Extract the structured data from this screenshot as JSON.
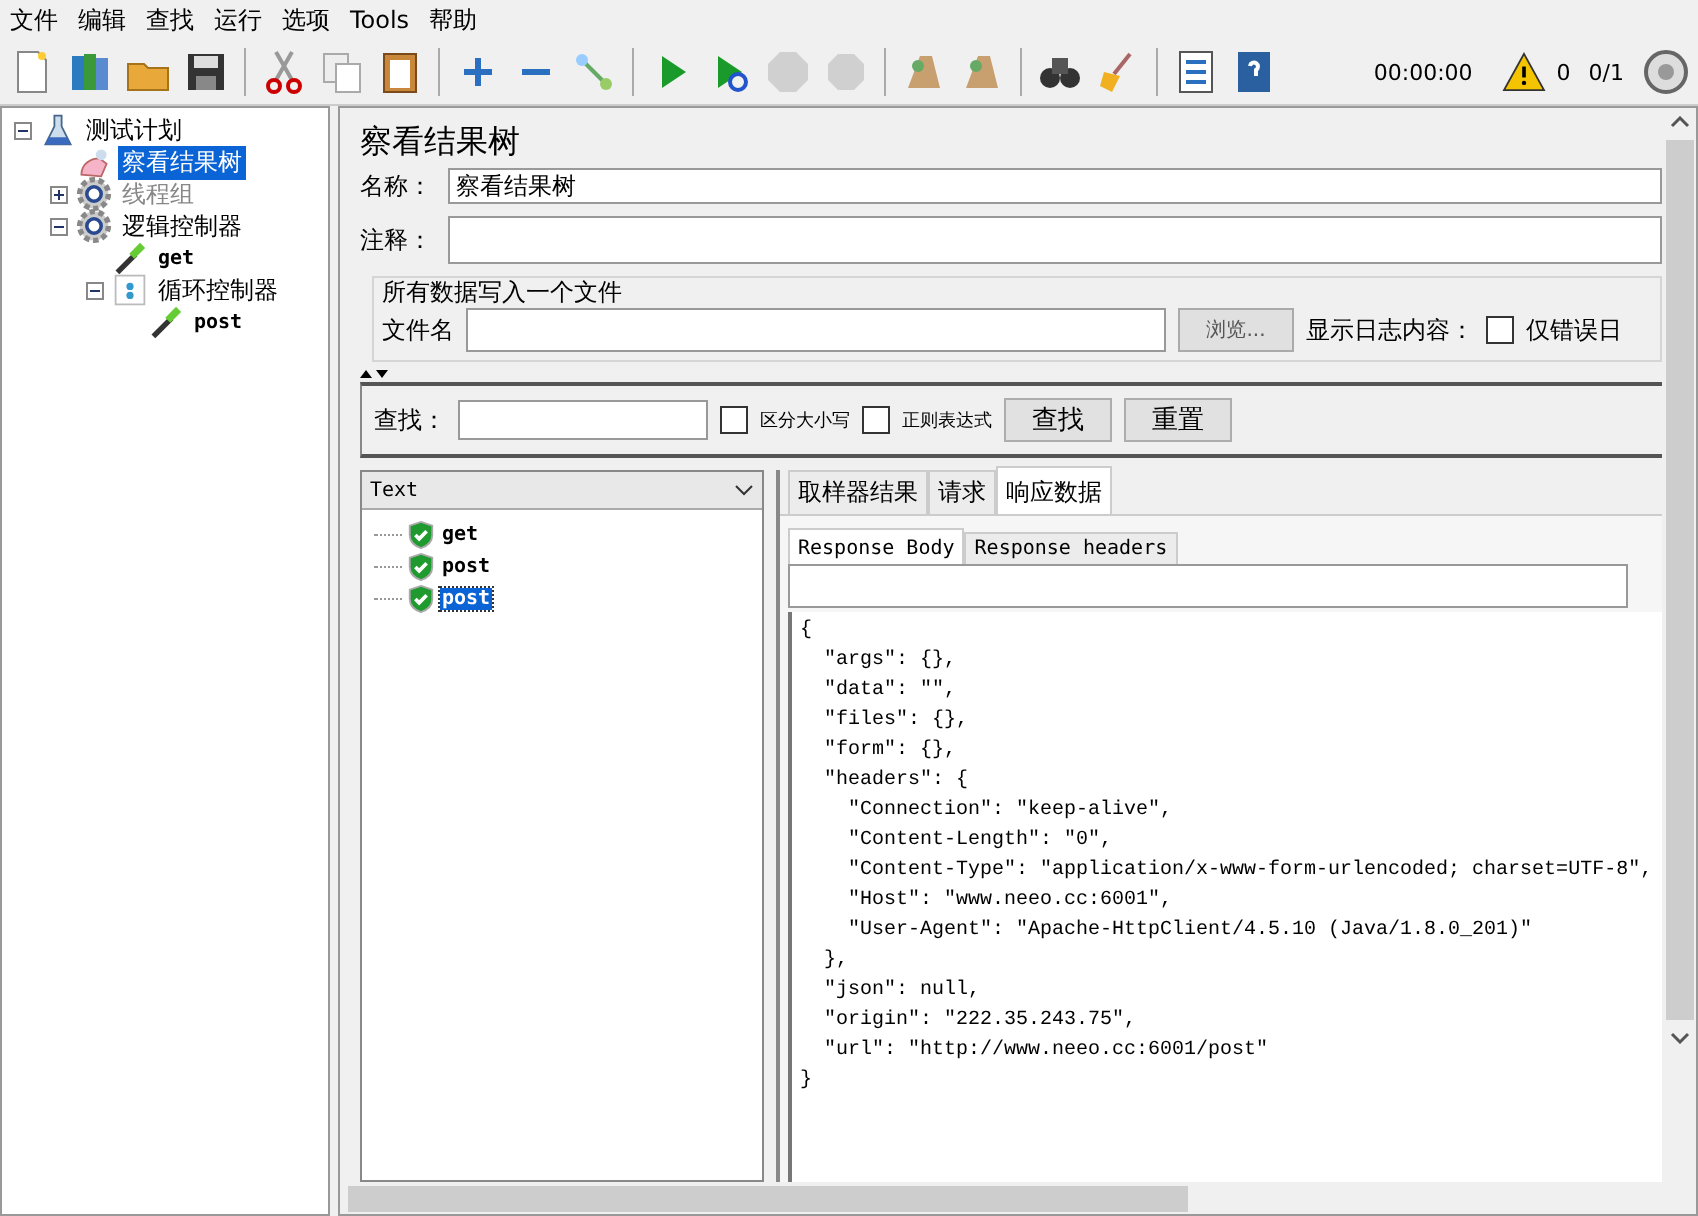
{
  "menu": [
    {
      "label": "文件"
    },
    {
      "label": "编辑"
    },
    {
      "label": "查找"
    },
    {
      "label": "运行"
    },
    {
      "label": "选项"
    },
    {
      "label": "Tools"
    },
    {
      "label": "帮助"
    }
  ],
  "toolbar": {
    "buttons": [
      {
        "kind": "new",
        "disabled": false
      },
      {
        "kind": "templates",
        "disabled": false
      },
      {
        "kind": "open",
        "disabled": false
      },
      {
        "kind": "save",
        "disabled": false
      },
      {
        "kind": "sep"
      },
      {
        "kind": "cut",
        "disabled": false
      },
      {
        "kind": "copy",
        "disabled": false
      },
      {
        "kind": "paste",
        "disabled": false
      },
      {
        "kind": "sep"
      },
      {
        "kind": "expand",
        "disabled": false
      },
      {
        "kind": "collapse",
        "disabled": false
      },
      {
        "kind": "toggle",
        "disabled": false
      },
      {
        "kind": "sep"
      },
      {
        "kind": "start",
        "disabled": false
      },
      {
        "kind": "start-no-timers",
        "disabled": false
      },
      {
        "kind": "stop",
        "disabled": true
      },
      {
        "kind": "shutdown",
        "disabled": true
      },
      {
        "kind": "sep"
      },
      {
        "kind": "clear",
        "disabled": false
      },
      {
        "kind": "clear-all",
        "disabled": false
      },
      {
        "kind": "sep"
      },
      {
        "kind": "search",
        "disabled": false
      },
      {
        "kind": "reset",
        "disabled": false
      },
      {
        "kind": "sep"
      },
      {
        "kind": "functions",
        "disabled": false
      },
      {
        "kind": "help",
        "disabled": false
      }
    ],
    "timer": "00:00:00",
    "warnings": "0",
    "threads": "0/1"
  },
  "tree": [
    {
      "label": "测试计划",
      "kind": "plan",
      "expanded": true,
      "selected": false,
      "disabled": false,
      "children": [
        {
          "label": "察看结果树",
          "kind": "listener",
          "selected": true,
          "disabled": false
        },
        {
          "label": "线程组",
          "kind": "threadgroup",
          "expanded": false,
          "selected": false,
          "disabled": true
        },
        {
          "label": "逻辑控制器",
          "kind": "threadgroup",
          "expanded": true,
          "selected": false,
          "disabled": false,
          "children": [
            {
              "label": "get",
              "kind": "sampler",
              "selected": false,
              "disabled": false
            },
            {
              "label": "循环控制器",
              "kind": "loop",
              "expanded": true,
              "selected": false,
              "disabled": false,
              "children": [
                {
                  "label": "post",
                  "kind": "sampler",
                  "selected": false,
                  "disabled": false
                }
              ]
            }
          ]
        }
      ]
    }
  ],
  "panel": {
    "title": "察看结果树",
    "name_label": "名称：",
    "name_value": "察看结果树",
    "comment_label": "注释：",
    "file_group": "所有数据写入一个文件",
    "filename_label": "文件名",
    "browse_button": "浏览...",
    "log_label": "显示日志内容：",
    "errors_only": {
      "label": "仅错误日",
      "checked": false
    }
  },
  "search": {
    "label": "查找：",
    "case_sensitive": {
      "label": "区分大小写",
      "checked": false
    },
    "regex": {
      "label": "正则表达式",
      "checked": false
    },
    "find_button": "查找",
    "reset_button": "重置"
  },
  "results": {
    "renderer": "Text",
    "items": [
      {
        "label": "get",
        "selected": false
      },
      {
        "label": "post",
        "selected": false
      },
      {
        "label": "post",
        "selected": true
      }
    ]
  },
  "tabs": [
    {
      "label": "取样器结果",
      "selected": false
    },
    {
      "label": "请求",
      "selected": false
    },
    {
      "label": "响应数据",
      "selected": true
    }
  ],
  "subtabs": [
    {
      "label": "Response Body",
      "selected": true
    },
    {
      "label": "Response headers",
      "selected": false
    }
  ],
  "response_body": [
    "{",
    "  \"args\": {},",
    "  \"data\": \"\",",
    "  \"files\": {},",
    "  \"form\": {},",
    "  \"headers\": {",
    "    \"Connection\": \"keep-alive\",",
    "    \"Content-Length\": \"0\",",
    "    \"Content-Type\": \"application/x-www-form-urlencoded; charset=UTF-8\",",
    "    \"Host\": \"www.neeo.cc:6001\",",
    "    \"User-Agent\": \"Apache-HttpClient/4.5.10 (Java/1.8.0_201)\"",
    "  },",
    "  \"json\": null,",
    "  \"origin\": \"222.35.243.75\",",
    "  \"url\": \"http://www.neeo.cc:6001/post\"",
    "}"
  ]
}
